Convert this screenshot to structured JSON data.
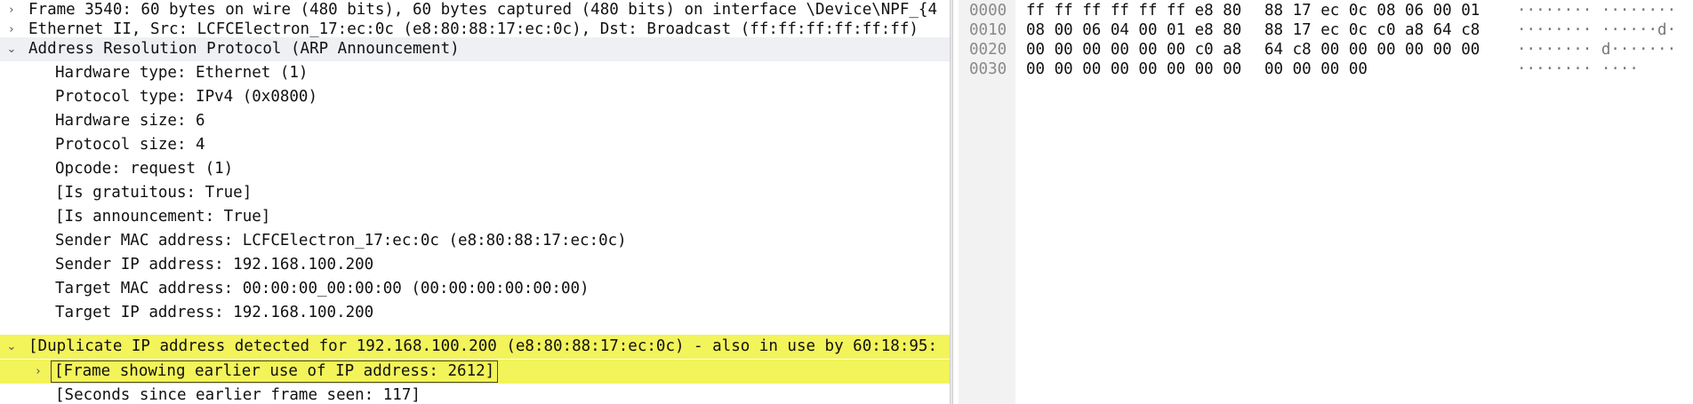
{
  "details": {
    "rows": [
      {
        "arrow": "›",
        "text": "Frame 3540: 60 bytes on wire (480 bits), 60 bytes captured (480 bits) on interface \\Device\\NPF_{4"
      },
      {
        "arrow": "›",
        "text": "Ethernet II, Src: LCFCElectron_17:ec:0c (e8:80:88:17:ec:0c), Dst: Broadcast (ff:ff:ff:ff:ff:ff)"
      },
      {
        "arrow": "⌄",
        "text": "Address Resolution Protocol (ARP Announcement)"
      },
      {
        "text": "Hardware type: Ethernet (1)"
      },
      {
        "text": "Protocol type: IPv4 (0x0800)"
      },
      {
        "text": "Hardware size: 6"
      },
      {
        "text": "Protocol size: 4"
      },
      {
        "text": "Opcode: request (1)"
      },
      {
        "text": "[Is gratuitous: True]"
      },
      {
        "text": "[Is announcement: True]"
      },
      {
        "text": "Sender MAC address: LCFCElectron_17:ec:0c (e8:80:88:17:ec:0c)"
      },
      {
        "text": "Sender IP address: 192.168.100.200"
      },
      {
        "text": "Target MAC address: 00:00:00_00:00:00 (00:00:00:00:00:00)"
      },
      {
        "text": "Target IP address: 192.168.100.200"
      },
      {
        "arrow": "⌄",
        "text": "[Duplicate IP address detected for 192.168.100.200 (e8:80:88:17:ec:0c) - also in use by 60:18:95:"
      },
      {
        "arrow": "›",
        "text": "[Frame showing earlier use of IP address: 2612]"
      },
      {
        "text": "[Seconds since earlier frame seen: 117]"
      }
    ]
  },
  "bytes": {
    "rows": [
      {
        "offset": "0000",
        "hex1": "ff ff ff ff ff ff e8 80",
        "hex2": "88 17 ec 0c 08 06 00 01",
        "ascii": "········ ········"
      },
      {
        "offset": "0010",
        "hex1": "08 00 06 04 00 01 e8 80",
        "hex2": "88 17 ec 0c c0 a8 64 c8",
        "ascii": "········ ······d·"
      },
      {
        "offset": "0020",
        "hex1": "00 00 00 00 00 00 c0 a8",
        "hex2": "64 c8 00 00 00 00 00 00",
        "ascii": "········ d·······"
      },
      {
        "offset": "0030",
        "hex1": "00 00 00 00 00 00 00 00",
        "hex2": "00 00 00 00",
        "ascii": "········ ····"
      }
    ]
  },
  "colors": {
    "warning_highlight": "#f3f35a",
    "selected_row": "#eef0f3",
    "offset_gutter": "#f2f2f2"
  }
}
